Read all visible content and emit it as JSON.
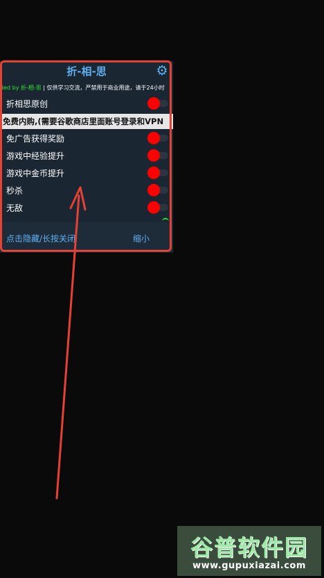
{
  "panel": {
    "title": "折-相-思",
    "credit_prefix": "ded by ",
    "credit_name": "折-相-思",
    "credit_text": " | 仅供学习交流，严禁用于商业用途，请于24小时",
    "banner": "免费内购,(需要谷歌商店里面账号登录和VPN",
    "rows": [
      {
        "label": "折相思原创",
        "enabled": false
      },
      {
        "label": "免广告获得奖励",
        "enabled": false
      },
      {
        "label": "游戏中经验提升",
        "enabled": false
      },
      {
        "label": "游戏中金币提升",
        "enabled": false
      },
      {
        "label": "秒杀",
        "enabled": false
      },
      {
        "label": "无敌",
        "enabled": false
      }
    ],
    "footer_left": "点击隐藏/长按关闭",
    "footer_right": "缩小"
  },
  "watermark": {
    "title": "谷普软件园",
    "url": "www.gupuxiazai.com"
  },
  "colors": {
    "accent": "#5fb0f0",
    "toggle_off": "#ff0000",
    "highlight": "#e34234",
    "credit_green": "#2ee82e"
  }
}
